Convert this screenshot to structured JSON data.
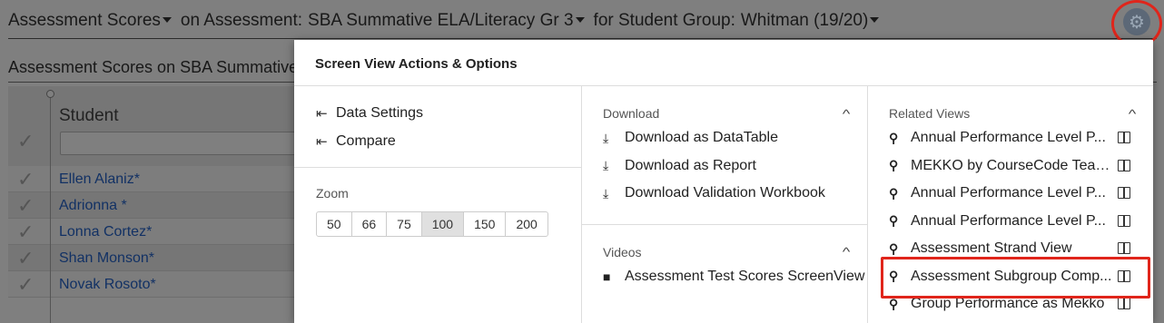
{
  "header": {
    "measure": "Assessment Scores",
    "on_label": "on Assessment:",
    "assessment": "SBA Summative ELA/Literacy Gr 3",
    "group_label": "for Student Group:",
    "group": "Whitman (19/20)"
  },
  "subtitle": "Assessment Scores on SBA Summative",
  "grid": {
    "column_header": "Student",
    "students": [
      "Ellen Alaniz*",
      "Adrionna *",
      "Lonna Cortez*",
      "Shan Monson*",
      "Novak Rosoto*"
    ]
  },
  "modal": {
    "title": "Screen View Actions & Options",
    "nav": [
      {
        "label": "Data Settings",
        "icon": "back-arrow-icon"
      },
      {
        "label": "Compare",
        "icon": "back-arrow-icon"
      }
    ],
    "zoom": {
      "label": "Zoom",
      "options": [
        "50",
        "66",
        "75",
        "100",
        "150",
        "200"
      ],
      "selected": "100"
    },
    "download": {
      "heading": "Download",
      "items": [
        "Download as DataTable",
        "Download as Report",
        "Download Validation Workbook"
      ]
    },
    "videos": {
      "heading": "Videos",
      "items": [
        "Assessment Test Scores ScreenView"
      ]
    },
    "related": {
      "heading": "Related Views",
      "items": [
        "Annual Performance Level P...",
        "MEKKO by CourseCode Teac...",
        "Annual Performance Level P...",
        "Annual Performance Level P...",
        "Assessment Strand View",
        "Assessment Subgroup Comp...",
        "Group Performance as Mekko"
      ]
    }
  },
  "colors": {
    "highlight": "#e0251b",
    "link": "#2563c9"
  }
}
